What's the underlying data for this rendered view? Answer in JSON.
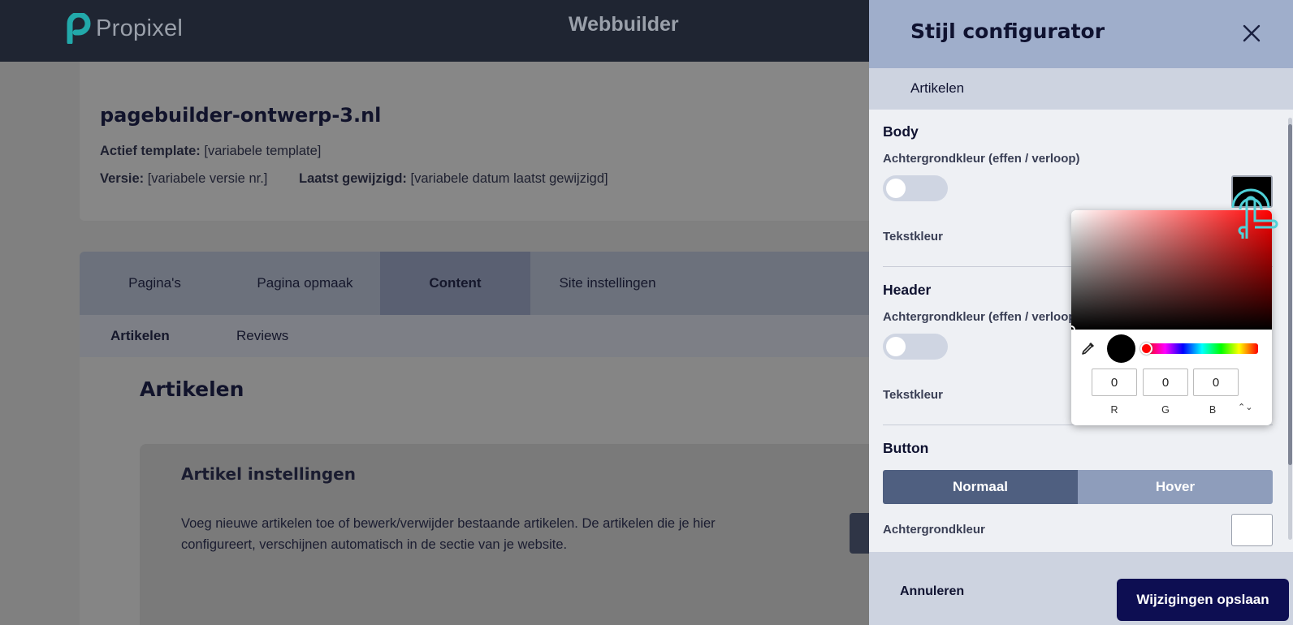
{
  "topbar": {
    "logo_text": "Propixel",
    "app_title": "Webbuilder"
  },
  "site": {
    "name": "pagebuilder-ontwerp-3.nl",
    "template_label": "Actief template:",
    "template_value": "[variabele template]",
    "version_label": "Versie:",
    "version_value": "[variabele versie nr.]",
    "modified_label": "Laatst gewijzigd:",
    "modified_value": "[variabele datum laatst gewijzigd]"
  },
  "tabs": [
    {
      "label": "Pagina's"
    },
    {
      "label": "Pagina opmaak"
    },
    {
      "label": "Content"
    },
    {
      "label": "Site instellingen"
    }
  ],
  "subtabs": [
    {
      "label": "Artikelen"
    },
    {
      "label": "Reviews"
    }
  ],
  "content": {
    "title": "Artikelen",
    "card_title": "Artikel instellingen",
    "card_desc": "Voeg nieuwe artikelen toe of bewerk/verwijder bestaande artikelen. De artikelen die je hier configureert, verschijnen automatisch in de sectie van je website."
  },
  "panel": {
    "title": "Stijl configurator",
    "subheader": "Artikelen",
    "sections": {
      "body": {
        "title": "Body",
        "bg_label": "Achtergrondkleur (effen / verloop)",
        "text_label": "Tekstkleur"
      },
      "header": {
        "title": "Header",
        "bg_label": "Achtergrondkleur (effen / verloop)",
        "text_label": "Tekstkleur"
      },
      "button": {
        "title": "Button",
        "state_normal": "Normaal",
        "state_hover": "Hover",
        "bg_label": "Achtergrondkleur"
      }
    },
    "cancel_label": "Annuleren",
    "save_label": "Wijzigingen opslaan"
  },
  "picker": {
    "r": "0",
    "g": "0",
    "b": "0",
    "r_label": "R",
    "g_label": "G",
    "b_label": "B",
    "format_toggle": "⌃⌄",
    "current_color": "#000000"
  },
  "colors": {
    "accent": "#0d0e52",
    "brand": "#2bb5b5",
    "segment_active": "#4f5f80"
  }
}
